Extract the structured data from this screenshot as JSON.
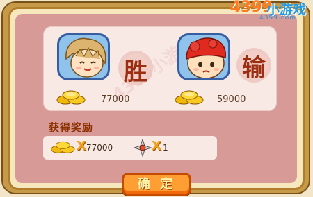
{
  "brand": {
    "name": "4399",
    "tagline": "小游戏",
    "url": "4399.com"
  },
  "players": [
    {
      "outcome": "胜",
      "score": "77000",
      "avatar": "blond-boy-smiling"
    },
    {
      "outcome": "输",
      "score": "59000",
      "avatar": "red-cap-girl-sad"
    }
  ],
  "watermark": "4399小游戏",
  "rewards": {
    "title": "获得奖励",
    "items": [
      {
        "icon": "gold-coins-icon",
        "multiplier": "X",
        "amount": "77000"
      },
      {
        "icon": "compass-star-icon",
        "multiplier": "X",
        "amount": "1"
      }
    ]
  },
  "confirm_button": "确 定",
  "colors": {
    "frame": "#c79a49",
    "panel": "#d79a97",
    "accent": "#ff9e32",
    "outcome": "#9b2d11"
  }
}
